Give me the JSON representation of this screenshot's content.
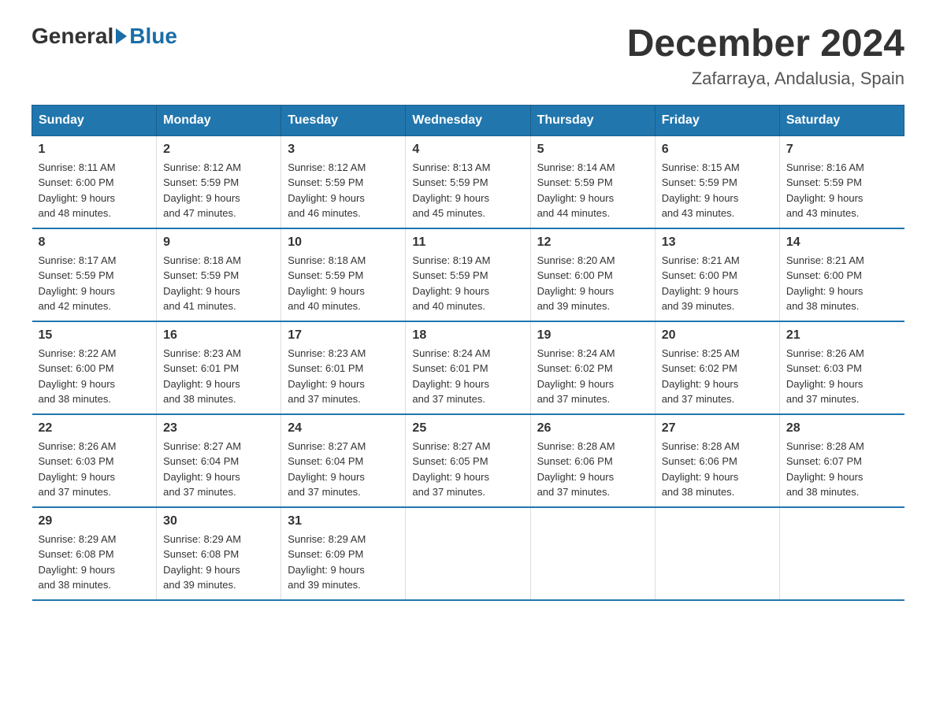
{
  "logo": {
    "general": "General",
    "blue": "Blue"
  },
  "title": "December 2024",
  "location": "Zafarraya, Andalusia, Spain",
  "headers": [
    "Sunday",
    "Monday",
    "Tuesday",
    "Wednesday",
    "Thursday",
    "Friday",
    "Saturday"
  ],
  "weeks": [
    [
      {
        "day": "1",
        "sunrise": "8:11 AM",
        "sunset": "6:00 PM",
        "daylight": "9 hours and 48 minutes."
      },
      {
        "day": "2",
        "sunrise": "8:12 AM",
        "sunset": "5:59 PM",
        "daylight": "9 hours and 47 minutes."
      },
      {
        "day": "3",
        "sunrise": "8:12 AM",
        "sunset": "5:59 PM",
        "daylight": "9 hours and 46 minutes."
      },
      {
        "day": "4",
        "sunrise": "8:13 AM",
        "sunset": "5:59 PM",
        "daylight": "9 hours and 45 minutes."
      },
      {
        "day": "5",
        "sunrise": "8:14 AM",
        "sunset": "5:59 PM",
        "daylight": "9 hours and 44 minutes."
      },
      {
        "day": "6",
        "sunrise": "8:15 AM",
        "sunset": "5:59 PM",
        "daylight": "9 hours and 43 minutes."
      },
      {
        "day": "7",
        "sunrise": "8:16 AM",
        "sunset": "5:59 PM",
        "daylight": "9 hours and 43 minutes."
      }
    ],
    [
      {
        "day": "8",
        "sunrise": "8:17 AM",
        "sunset": "5:59 PM",
        "daylight": "9 hours and 42 minutes."
      },
      {
        "day": "9",
        "sunrise": "8:18 AM",
        "sunset": "5:59 PM",
        "daylight": "9 hours and 41 minutes."
      },
      {
        "day": "10",
        "sunrise": "8:18 AM",
        "sunset": "5:59 PM",
        "daylight": "9 hours and 40 minutes."
      },
      {
        "day": "11",
        "sunrise": "8:19 AM",
        "sunset": "5:59 PM",
        "daylight": "9 hours and 40 minutes."
      },
      {
        "day": "12",
        "sunrise": "8:20 AM",
        "sunset": "6:00 PM",
        "daylight": "9 hours and 39 minutes."
      },
      {
        "day": "13",
        "sunrise": "8:21 AM",
        "sunset": "6:00 PM",
        "daylight": "9 hours and 39 minutes."
      },
      {
        "day": "14",
        "sunrise": "8:21 AM",
        "sunset": "6:00 PM",
        "daylight": "9 hours and 38 minutes."
      }
    ],
    [
      {
        "day": "15",
        "sunrise": "8:22 AM",
        "sunset": "6:00 PM",
        "daylight": "9 hours and 38 minutes."
      },
      {
        "day": "16",
        "sunrise": "8:23 AM",
        "sunset": "6:01 PM",
        "daylight": "9 hours and 38 minutes."
      },
      {
        "day": "17",
        "sunrise": "8:23 AM",
        "sunset": "6:01 PM",
        "daylight": "9 hours and 37 minutes."
      },
      {
        "day": "18",
        "sunrise": "8:24 AM",
        "sunset": "6:01 PM",
        "daylight": "9 hours and 37 minutes."
      },
      {
        "day": "19",
        "sunrise": "8:24 AM",
        "sunset": "6:02 PM",
        "daylight": "9 hours and 37 minutes."
      },
      {
        "day": "20",
        "sunrise": "8:25 AM",
        "sunset": "6:02 PM",
        "daylight": "9 hours and 37 minutes."
      },
      {
        "day": "21",
        "sunrise": "8:26 AM",
        "sunset": "6:03 PM",
        "daylight": "9 hours and 37 minutes."
      }
    ],
    [
      {
        "day": "22",
        "sunrise": "8:26 AM",
        "sunset": "6:03 PM",
        "daylight": "9 hours and 37 minutes."
      },
      {
        "day": "23",
        "sunrise": "8:27 AM",
        "sunset": "6:04 PM",
        "daylight": "9 hours and 37 minutes."
      },
      {
        "day": "24",
        "sunrise": "8:27 AM",
        "sunset": "6:04 PM",
        "daylight": "9 hours and 37 minutes."
      },
      {
        "day": "25",
        "sunrise": "8:27 AM",
        "sunset": "6:05 PM",
        "daylight": "9 hours and 37 minutes."
      },
      {
        "day": "26",
        "sunrise": "8:28 AM",
        "sunset": "6:06 PM",
        "daylight": "9 hours and 37 minutes."
      },
      {
        "day": "27",
        "sunrise": "8:28 AM",
        "sunset": "6:06 PM",
        "daylight": "9 hours and 38 minutes."
      },
      {
        "day": "28",
        "sunrise": "8:28 AM",
        "sunset": "6:07 PM",
        "daylight": "9 hours and 38 minutes."
      }
    ],
    [
      {
        "day": "29",
        "sunrise": "8:29 AM",
        "sunset": "6:08 PM",
        "daylight": "9 hours and 38 minutes."
      },
      {
        "day": "30",
        "sunrise": "8:29 AM",
        "sunset": "6:08 PM",
        "daylight": "9 hours and 39 minutes."
      },
      {
        "day": "31",
        "sunrise": "8:29 AM",
        "sunset": "6:09 PM",
        "daylight": "9 hours and 39 minutes."
      },
      null,
      null,
      null,
      null
    ]
  ],
  "labels": {
    "sunrise": "Sunrise:",
    "sunset": "Sunset:",
    "daylight": "Daylight:"
  }
}
